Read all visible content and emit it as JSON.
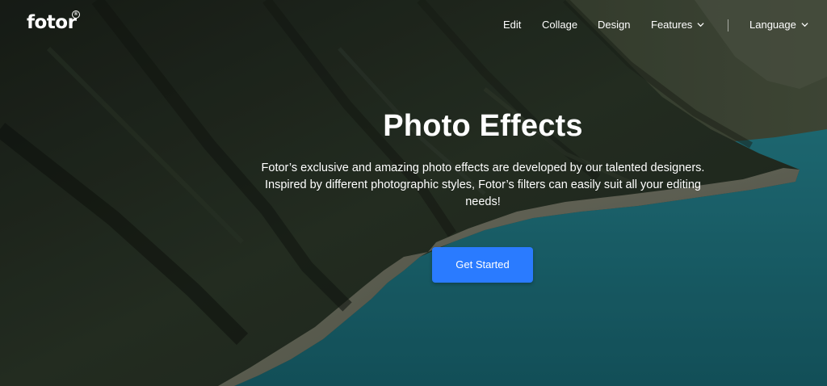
{
  "header": {
    "logo_text": "fotor",
    "logo_mark": "®",
    "nav": {
      "edit": "Edit",
      "collage": "Collage",
      "design": "Design",
      "features": "Features",
      "language": "Language"
    }
  },
  "hero": {
    "title": "Photo Effects",
    "description_line1": "Fotor’s exclusive and amazing photo effects are developed by our talented designers.",
    "description_line2": "Inspired by different photographic styles, Fotor’s filters can easily suit all your editing",
    "description_line3": "needs!",
    "cta_label": "Get Started"
  },
  "colors": {
    "accent": "#2a7bff",
    "water": "#1f7a86",
    "mountain": "#2a3427",
    "text": "#ffffff"
  },
  "icons": {
    "features_dropdown": "chevron-down-icon",
    "language_dropdown": "chevron-down-icon"
  }
}
